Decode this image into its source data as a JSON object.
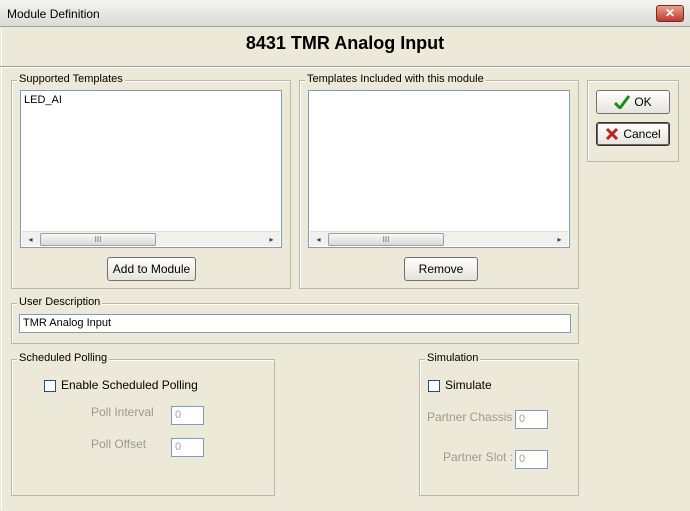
{
  "window": {
    "title": "Module Definition",
    "close_glyph": "✕"
  },
  "heading": "8431 TMR Analog Input",
  "supported_templates": {
    "label": "Supported Templates",
    "items": [
      "LED_AI"
    ],
    "add_button": "Add to Module"
  },
  "included_templates": {
    "label": "Templates Included with this module",
    "items": [],
    "remove_button": "Remove"
  },
  "buttons": {
    "ok": "OK",
    "cancel": "Cancel"
  },
  "user_description": {
    "label": "User Description",
    "value": "TMR Analog Input"
  },
  "scheduled_polling": {
    "label": "Scheduled Polling",
    "enable_label": "Enable Scheduled Polling",
    "enabled": false,
    "poll_interval_label": "Poll Interval",
    "poll_interval_value": "0",
    "poll_offset_label": "Poll Offset",
    "poll_offset_value": "0"
  },
  "simulation": {
    "label": "Simulation",
    "simulate_label": "Simulate",
    "simulate": false,
    "partner_chassis_label": "Partner Chassis :",
    "partner_chassis_value": "0",
    "partner_slot_label": "Partner Slot :",
    "partner_slot_value": "0"
  },
  "scrollbar": {
    "left_glyph": "◂",
    "right_glyph": "▸",
    "thumb_glyph": "III"
  },
  "colors": {
    "ok_check": "#1a8f1a",
    "cancel_x": "#c0201a",
    "border": "#7f9db9"
  }
}
